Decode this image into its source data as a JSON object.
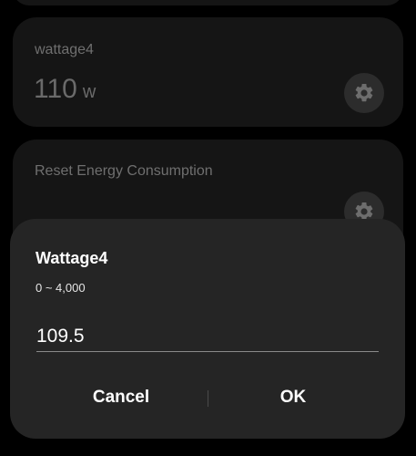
{
  "cards": {
    "wattage": {
      "label": "wattage4",
      "value": "110",
      "unit": "w"
    },
    "reset": {
      "label": "Reset Energy Consumption"
    }
  },
  "dialog": {
    "title": "Wattage4",
    "range": "0 ~ 4,000",
    "input_value": "109.5",
    "cancel_label": "Cancel",
    "ok_label": "OK"
  },
  "icons": {
    "settings": "gear-icon"
  },
  "colors": {
    "background": "#000000",
    "card": "#151515",
    "dialog": "#252525",
    "text": "#ffffff"
  }
}
